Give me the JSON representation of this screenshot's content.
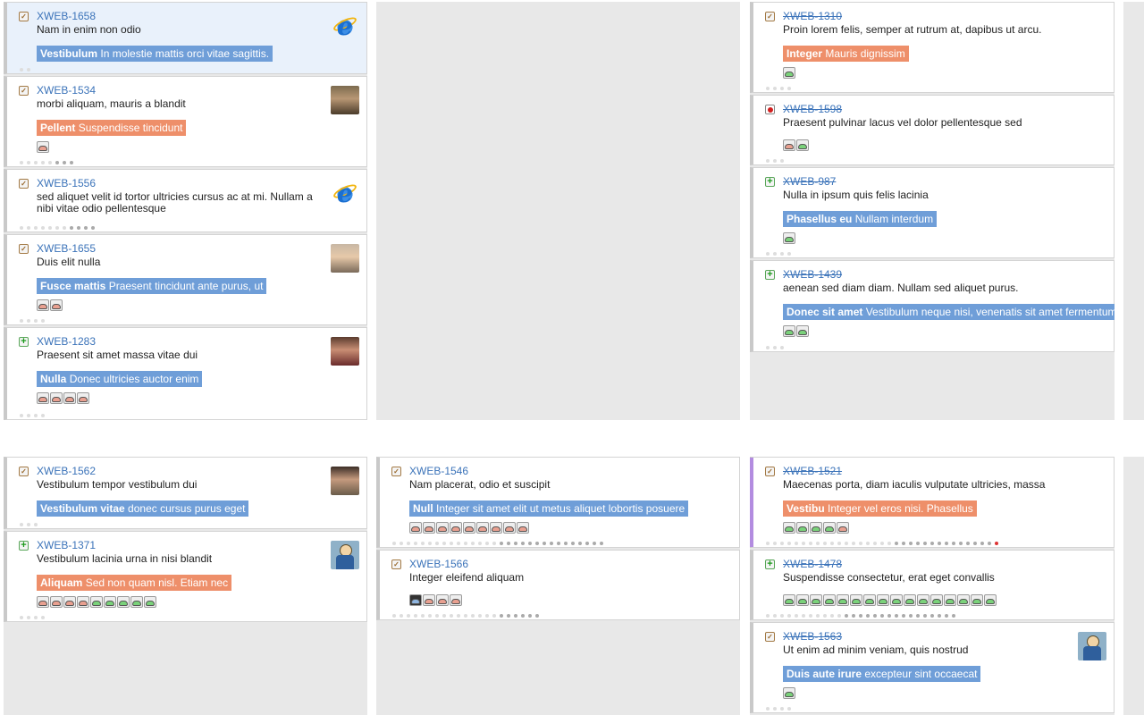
{
  "board": {
    "cards": [
      {
        "key": "XWEB-1658",
        "summary": "Nam in enim non odio",
        "epic_bold": "Vestibulum",
        "epic_text": "In molestie mattis orci vitae sagittis.",
        "epic_color": "blue",
        "type": "task-icon"
      },
      {
        "key": "XWEB-1534",
        "summary": "morbi aliquam, mauris a blandit",
        "epic_bold": "Pellent",
        "epic_text": "Suspendisse tincidunt",
        "epic_color": "orange",
        "type": "task-icon"
      },
      {
        "key": "XWEB-1556",
        "summary": "sed aliquet velit id tortor ultricies cursus ac at mi. Nullam a nibi vitae odio pellentesque",
        "type": "task-icon"
      },
      {
        "key": "XWEB-1655",
        "summary": "Duis elit nulla",
        "epic_bold": "Fusce mattis",
        "epic_text": "Praesent tincidunt ante purus, ut",
        "epic_color": "blue",
        "type": "task-icon"
      },
      {
        "key": "XWEB-1283",
        "summary": "Praesent sit amet massa vitae dui",
        "epic_bold": "Nulla",
        "epic_text": "Donec ultricies auctor enim",
        "epic_color": "blue",
        "type": "feature-icon"
      },
      {
        "key": "XWEB-1310",
        "summary": "Proin lorem felis, semper at rutrum at, dapibus ut arcu.",
        "epic_bold": "Integer",
        "epic_text": "Mauris dignissim",
        "epic_color": "orange",
        "type": "task-icon"
      },
      {
        "key": "XWEB-1598",
        "summary": "Praesent pulvinar lacus vel dolor pellentesque sed",
        "type": "bug-icon"
      },
      {
        "key": "XWEB-987",
        "summary": "Nulla in ipsum quis felis lacinia",
        "epic_bold": "Phasellus eu",
        "epic_text": "Nullam interdum",
        "epic_color": "blue",
        "type": "feature-icon"
      },
      {
        "key": "XWEB-1439",
        "summary": "aenean sed diam diam. Nullam sed aliquet purus.",
        "epic_bold": "Donec sit amet",
        "epic_text": "Vestibulum neque nisi, venenatis sit amet fermentum",
        "epic_color": "blue",
        "type": "feature-icon"
      },
      {
        "key": "XWEB-1562",
        "summary": "Vestibulum tempor vestibulum dui",
        "epic_bold": "Vestibulum vitae",
        "epic_text": "donec cursus purus eget",
        "epic_color": "blue",
        "type": "task-icon"
      },
      {
        "key": "XWEB-1371",
        "summary": "Vestibulum lacinia urna in nisi blandit",
        "epic_bold": "Aliquam",
        "epic_text": "Sed non quam nisl. Etiam nec",
        "epic_color": "orange",
        "type": "feature-icon"
      },
      {
        "key": "XWEB-1546",
        "summary": "Nam placerat, odio et suscipit",
        "epic_bold": "Null",
        "epic_text": "Integer sit amet elit ut metus aliquet lobortis posuere",
        "epic_color": "blue",
        "type": "task-icon"
      },
      {
        "key": "XWEB-1566",
        "summary": "Integer eleifend aliquam",
        "type": "task-icon"
      },
      {
        "key": "XWEB-1521",
        "summary": "Maecenas porta, diam iaculis vulputate ultricies, massa",
        "epic_bold": "Vestibu",
        "epic_text": "Integer vel eros nisi. Phasellus",
        "epic_color": "orange",
        "type": "task-icon"
      },
      {
        "key": "XWEB-1478",
        "summary": "Suspendisse consectetur, erat eget convallis",
        "type": "feature-icon"
      },
      {
        "key": "XWEB-1563",
        "summary": "Ut enim ad minim veniam, quis nostrud",
        "epic_bold": "Duis aute irure",
        "epic_text": "excepteur sint occaecat",
        "epic_color": "blue",
        "type": "task-icon"
      }
    ]
  },
  "colors": {
    "link": "#3b73b9",
    "epic_blue": "#6f9ed8",
    "epic_orange": "#ee8f6a",
    "column_bg": "#e8e8e8",
    "highlight_card": "#e9f1fb",
    "flag_stripe": "#b38ce0"
  }
}
